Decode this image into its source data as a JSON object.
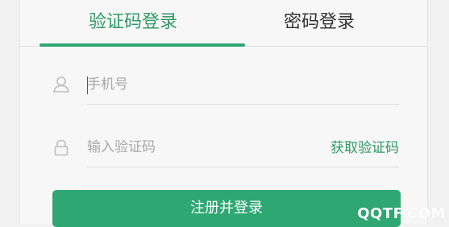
{
  "tabs": [
    {
      "label": "验证码登录",
      "active": true
    },
    {
      "label": "密码登录",
      "active": false
    }
  ],
  "phone": {
    "placeholder": "手机号",
    "value": ""
  },
  "code": {
    "placeholder": "输入验证码",
    "value": "",
    "get_code_label": "获取验证码"
  },
  "submit_label": "注册并登录",
  "watermark": "QQTF.COM",
  "colors": {
    "accent": "#2ea772",
    "accent_text": "#2f9a66",
    "background": "#f1f1f1"
  },
  "icons": {
    "phone_field": "user-icon",
    "code_field": "lock-icon"
  }
}
